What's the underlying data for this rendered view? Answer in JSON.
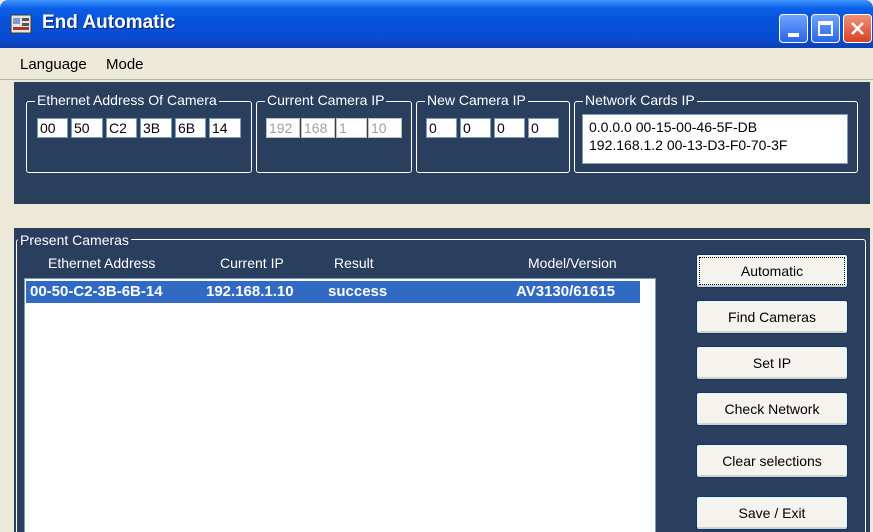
{
  "window": {
    "title": "End Automatic"
  },
  "menu": {
    "language": "Language",
    "mode": "Mode"
  },
  "groups": {
    "ethernet": {
      "label": "Ethernet Address Of Camera",
      "octets": [
        "00",
        "50",
        "C2",
        "3B",
        "6B",
        "14"
      ]
    },
    "current_ip": {
      "label": "Current Camera IP",
      "octets": [
        "192",
        "168",
        "1",
        "10"
      ],
      "enabled": false
    },
    "new_ip": {
      "label": "New Camera IP",
      "octets": [
        "0",
        "0",
        "0",
        "0"
      ]
    },
    "network_cards": {
      "label": "Network Cards IP",
      "lines": [
        "0.0.0.0  00-15-00-46-5F-DB",
        "192.168.1.2  00-13-D3-F0-70-3F"
      ]
    }
  },
  "present": {
    "label": "Present Cameras",
    "columns": [
      "Ethernet Address",
      "Current IP",
      "Result",
      "Model/Version"
    ],
    "rows": [
      {
        "ethernet": "00-50-C2-3B-6B-14",
        "ip": "192.168.1.10",
        "result": "success",
        "model": "AV3130/61615",
        "selected": true
      }
    ]
  },
  "buttons": {
    "automatic": "Automatic",
    "find": "Find Cameras",
    "set_ip": "Set IP",
    "check": "Check Network",
    "clear": "Clear selections",
    "save_exit": "Save / Exit"
  },
  "icons": [
    "app-icon",
    "minimize-icon",
    "maximize-icon",
    "close-icon"
  ],
  "colors": {
    "titlebar": "#0551d8",
    "panel": "#2a3e5e",
    "selection": "#316ac5",
    "close": "#d64226"
  }
}
